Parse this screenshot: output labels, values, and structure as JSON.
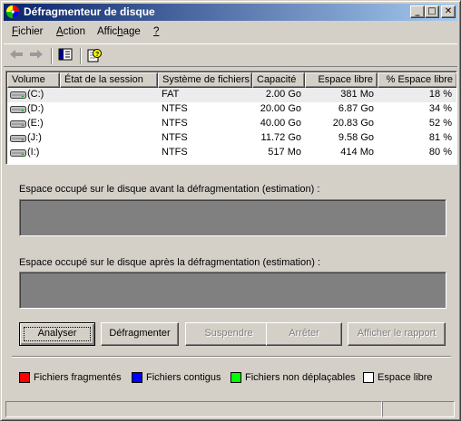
{
  "window": {
    "title": "Défragmenteur de disque"
  },
  "menu": [
    {
      "label": "Fichier",
      "accel": "F",
      "rest": "ichier"
    },
    {
      "label": "Action",
      "accel": "A",
      "rest": "ction"
    },
    {
      "label": "Affichage",
      "pre": "Affic",
      "accel": "h",
      "rest": "age"
    },
    {
      "label": "?",
      "accel": "?",
      "rest": ""
    }
  ],
  "toolbar": {
    "back_icon": "back-arrow-icon",
    "forward_icon": "forward-arrow-icon",
    "show_hide_icon": "show-hide-tree-icon",
    "help_icon": "help-icon"
  },
  "volumes": {
    "columns": [
      "Volume",
      "État de la session",
      "Système de fichiers",
      "Capacité",
      "Espace libre",
      "% Espace libre"
    ],
    "rows": [
      {
        "volume": "(C:)",
        "session": "",
        "fs": "FAT",
        "capacity": "2.00 Go",
        "free": "381 Mo",
        "pct": "18 %"
      },
      {
        "volume": "(D:)",
        "session": "",
        "fs": "NTFS",
        "capacity": "20.00 Go",
        "free": "6.87 Go",
        "pct": "34 %"
      },
      {
        "volume": "(E:)",
        "session": "",
        "fs": "NTFS",
        "capacity": "40.00 Go",
        "free": "20.83 Go",
        "pct": "52 %"
      },
      {
        "volume": "(J:)",
        "session": "",
        "fs": "NTFS",
        "capacity": "11.72 Go",
        "free": "9.58 Go",
        "pct": "81 %"
      },
      {
        "volume": "(I:)",
        "session": "",
        "fs": "NTFS",
        "capacity": "517 Mo",
        "free": "414 Mo",
        "pct": "80 %"
      }
    ]
  },
  "before_label": "Espace occupé sur le disque avant la défragmentation (estimation) :",
  "after_label": "Espace occupé sur le disque après la défragmentation (estimation) :",
  "buttons": {
    "analyze": "Analyser",
    "defragment": "Défragmenter",
    "pause": "Suspendre",
    "stop": "Arrêter",
    "report": "Afficher le rapport"
  },
  "legend": [
    {
      "label": "Fichiers fragmentés",
      "color": "#ff0000"
    },
    {
      "label": "Fichiers contigus",
      "color": "#0000ff"
    },
    {
      "label": "Fichiers non déplaçables",
      "color": "#00ff00"
    },
    {
      "label": "Espace libre",
      "color": "#ffffff"
    }
  ],
  "colors": {
    "titlebar_start": "#0a246a",
    "titlebar_end": "#a6caf0",
    "map_empty": "#808080",
    "face": "#d4d0c8"
  }
}
